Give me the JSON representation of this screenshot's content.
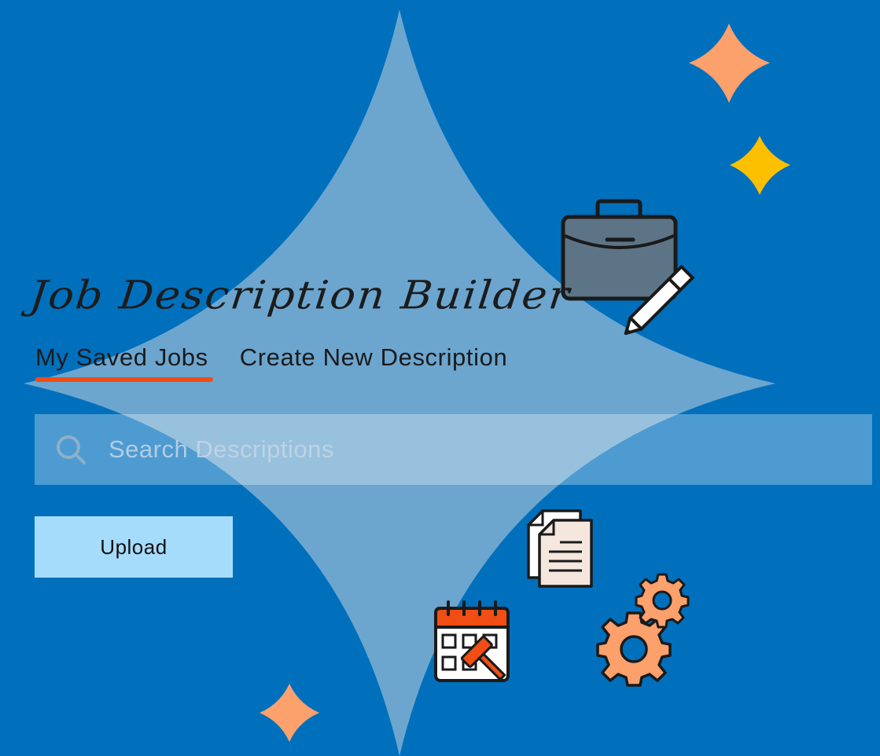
{
  "app": {
    "title": "Job Description Builder"
  },
  "tabs": [
    {
      "label": "My Saved Jobs",
      "active": true
    },
    {
      "label": "Create New Description",
      "active": false
    }
  ],
  "search": {
    "value": "",
    "placeholder": "Search Descriptions"
  },
  "actions": {
    "upload_label": "Upload"
  },
  "decorations": {
    "icons": [
      "briefcase-icon",
      "pencil-icon",
      "documents-icon",
      "calendar-gavel-icon",
      "gears-icon"
    ],
    "sparkles": [
      "sparkle-large-light",
      "sparkle-orange",
      "sparkle-yellow",
      "sparkle-orange-bottom"
    ]
  },
  "colors": {
    "background": "#0070bd",
    "accent": "#f04e14",
    "upload_button": "#a6dcfb",
    "sparkle_orange": "#fca06c",
    "sparkle_yellow": "#fdc000"
  }
}
